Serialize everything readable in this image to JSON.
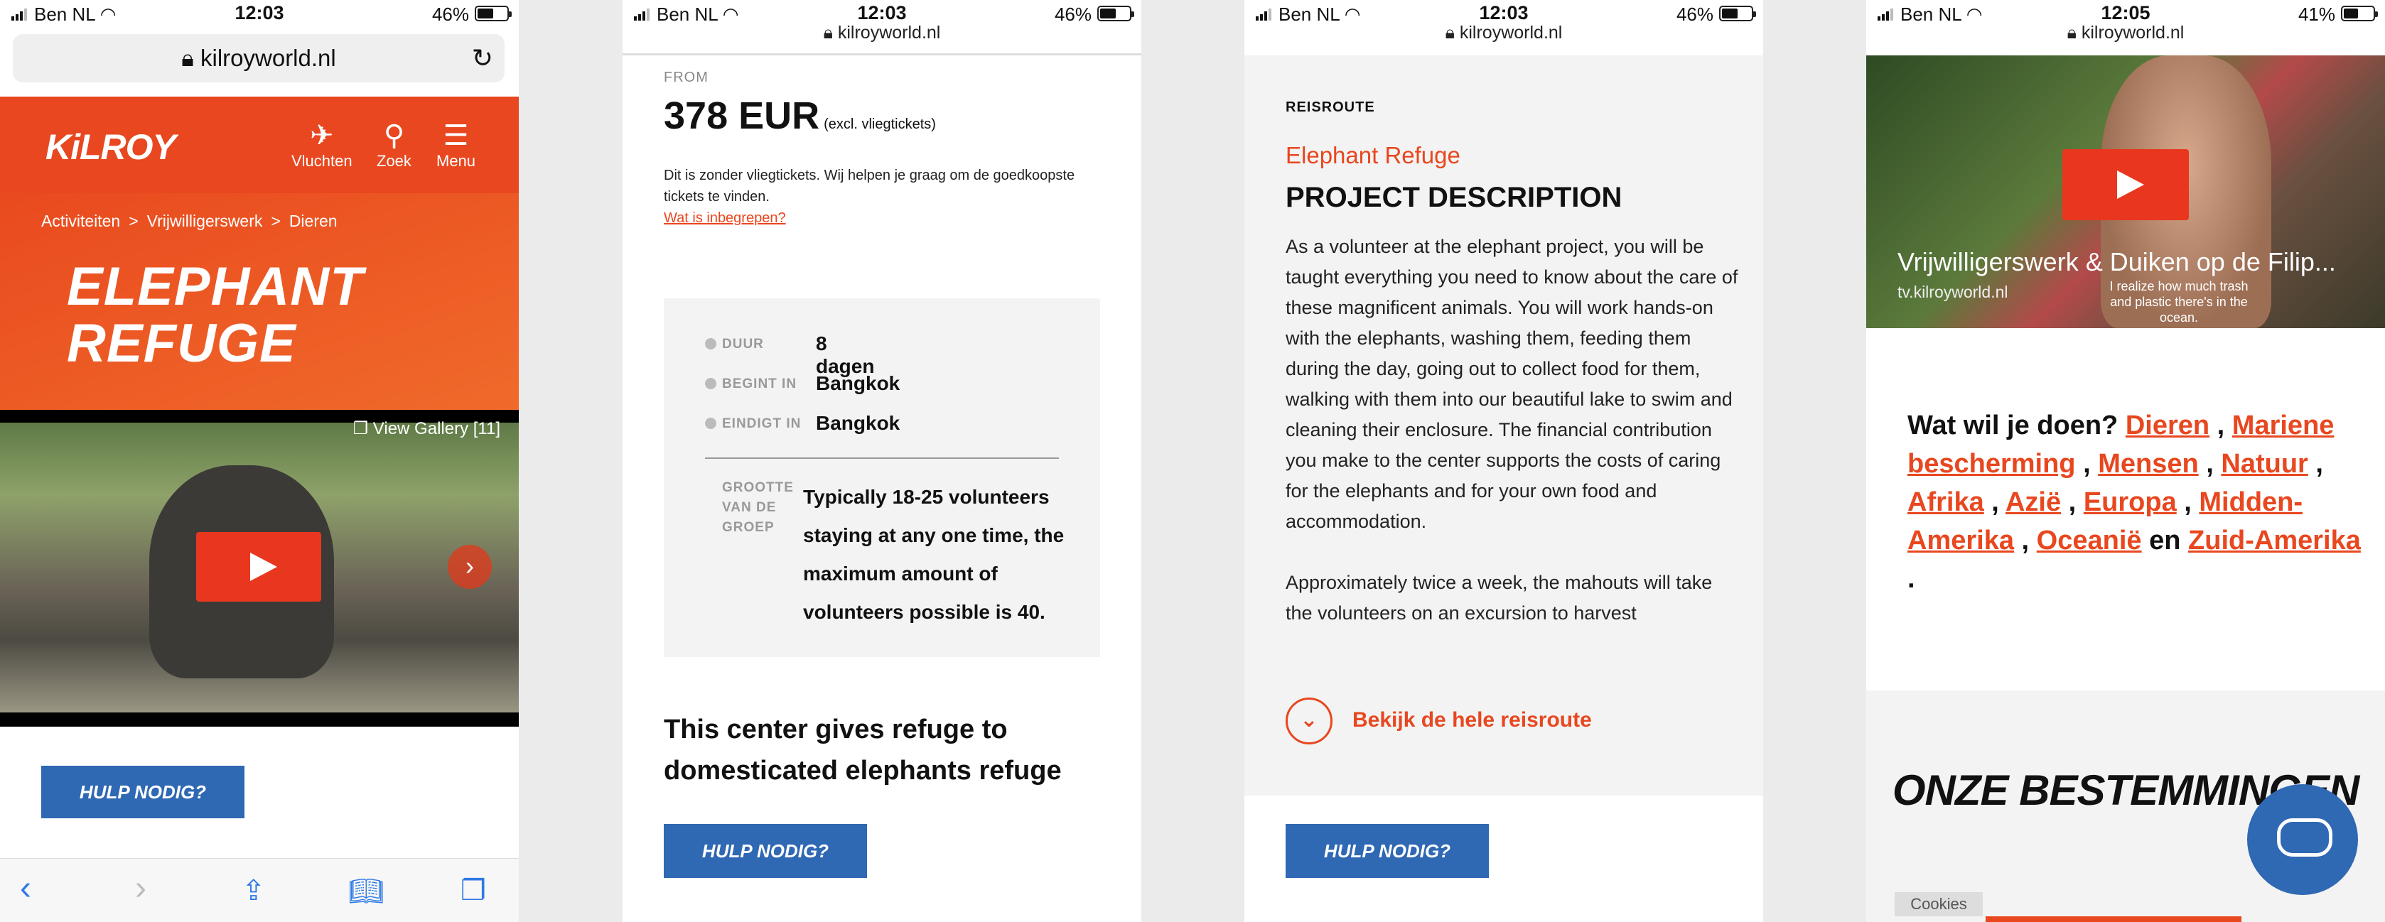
{
  "status": [
    {
      "carrier": "Ben NL",
      "time": "12:03",
      "battery": "46%"
    },
    {
      "carrier": "Ben NL",
      "time": "12:03",
      "battery": "46%"
    },
    {
      "carrier": "Ben NL",
      "time": "12:03",
      "battery": "46%"
    },
    {
      "carrier": "Ben NL",
      "time": "12:05",
      "battery": "41%"
    }
  ],
  "url": "kilroyworld.nl",
  "header": {
    "logo": "KiLROY",
    "nav": [
      "Vluchten",
      "Zoek",
      "Menu"
    ]
  },
  "breadcrumb": [
    "Activiteiten",
    ">",
    "Vrijwilligerswerk",
    ">",
    "Dieren"
  ],
  "title_line1": "ELEPHANT",
  "title_line2": "REFUGE",
  "gallery": "View Gallery [11]",
  "help": "HULP NODIG?",
  "price": {
    "from": "FROM",
    "amount": "378 EUR",
    "note": "(excl. vliegtickets)",
    "text": "Dit is zonder vliegtickets. Wij helpen je graag om de goedkoopste tickets te vinden.",
    "link": "Wat is inbegrepen?"
  },
  "facts": [
    {
      "k": "DUUR",
      "v": "8 dagen"
    },
    {
      "k": "BEGINT IN",
      "v": "Bangkok"
    },
    {
      "k": "EINDIGT IN",
      "v": "Bangkok"
    }
  ],
  "group": {
    "k": "GROOTTE VAN DE GROEP",
    "v": "Typically 18-25 volunteers staying at any one time, the maximum amount of volunteers possible is 40."
  },
  "center": "This center gives refuge to domesticated elephants refuge",
  "route": {
    "label": "REISROUTE",
    "name": "Elephant Refuge",
    "heading": "PROJECT DESCRIPTION",
    "p1": "As a volunteer at the elephant project, you will be taught everything you need to know about the care of these magnificent animals. You will work hands-on with the elephants, washing them, feeding them during the day, going out to collect food for them, walking with them into our beautiful lake to swim and cleaning their enclosure. The financial contribution you make to the center supports the costs of caring for the elephants and for your own food and accommodation.",
    "p2": "Approximately twice a week, the mahouts will take the volunteers on an excursion to harvest",
    "more": "Bekijk de hele reisroute"
  },
  "video4": {
    "title": "Vrijwilligerswerk & Duiken op de Filip...",
    "source": "tv.kilroyworld.nl",
    "caption": "I realize how much trash and plastic there's in the ocean."
  },
  "wat": {
    "q": "Wat wil je doen?",
    "links": [
      "Dieren",
      "Mariene bescherming",
      "Mensen",
      "Natuur",
      "Afrika",
      "Azië",
      "Europa",
      "Midden-Amerika",
      "Oceanië",
      "Zuid-Amerika"
    ],
    "en": "en"
  },
  "destinations": "ONZE BESTEMMINGEN",
  "cookies": "Cookies",
  "colors": {
    "brand": "#e8471f",
    "button": "#2f68b3"
  }
}
